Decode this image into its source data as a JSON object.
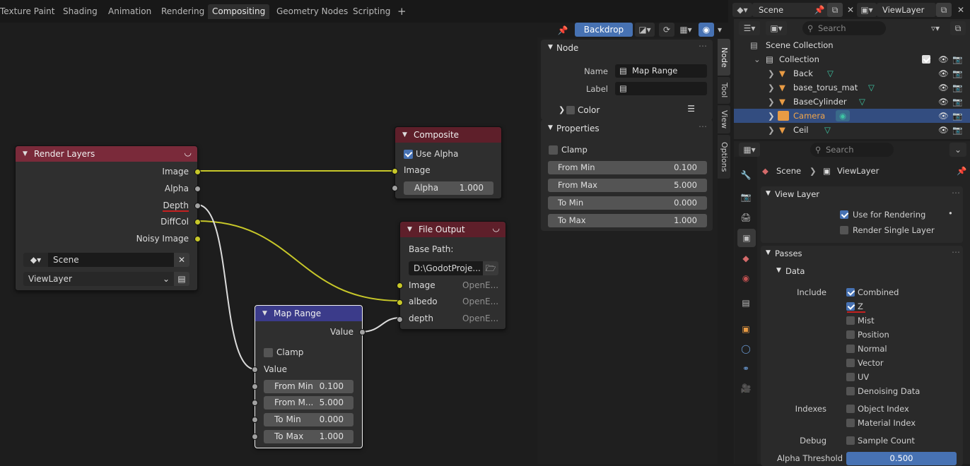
{
  "workspace_tabs": [
    "Texture Paint",
    "Shading",
    "Animation",
    "Rendering",
    "Compositing",
    "Geometry Nodes",
    "Scripting"
  ],
  "active_tab": "Compositing",
  "add_tab_symbol": "+",
  "scene": {
    "name": "Scene",
    "view_layer": "ViewLayer"
  },
  "header": {
    "backdrop_label": "Backdrop"
  },
  "nodes": {
    "render_layers": {
      "title": "Render Layers",
      "outputs": [
        "Image",
        "Alpha",
        "Depth",
        "DiffCol",
        "Noisy Image"
      ],
      "scene": "Scene",
      "view_layer": "ViewLayer"
    },
    "composite": {
      "title": "Composite",
      "use_alpha_label": "Use Alpha",
      "use_alpha": true,
      "input_image": "Image",
      "alpha_label": "Alpha",
      "alpha_value": "1.000"
    },
    "file_output": {
      "title": "File Output",
      "base_path_label": "Base Path:",
      "base_path": "D:\\GodotProje...",
      "inputs": [
        {
          "name": "Image",
          "format": "OpenE..."
        },
        {
          "name": "albedo",
          "format": "OpenE..."
        },
        {
          "name": "depth",
          "format": "OpenE..."
        }
      ]
    },
    "map_range": {
      "title": "Map Range",
      "output": "Value",
      "clamp_label": "Clamp",
      "input_value": "Value",
      "fields": [
        {
          "label": "From Min",
          "value": "0.100"
        },
        {
          "label": "From M...",
          "value": "5.000"
        },
        {
          "label": "To Min",
          "value": "0.000"
        },
        {
          "label": "To Max",
          "value": "1.000"
        }
      ]
    }
  },
  "sidebar": {
    "node_section": "Node",
    "name_label": "Name",
    "name_value": "Map Range",
    "label_label": "Label",
    "label_value": "",
    "color_label": "Color",
    "properties_section": "Properties",
    "clamp_label": "Clamp",
    "fields": [
      {
        "label": "From Min",
        "value": "0.100"
      },
      {
        "label": "From Max",
        "value": "5.000"
      },
      {
        "label": "To Min",
        "value": "0.000"
      },
      {
        "label": "To Max",
        "value": "1.000"
      }
    ],
    "tabs": [
      "Node",
      "Tool",
      "View",
      "Options"
    ]
  },
  "outliner": {
    "search_placeholder": "Search",
    "root": "Scene Collection",
    "collection": "Collection",
    "items": [
      "Back",
      "base_torus_mat",
      "BaseCylinder",
      "Camera",
      "Ceil"
    ],
    "selected": "Camera"
  },
  "properties": {
    "search_placeholder": "Search",
    "breadcrumb_scene": "Scene",
    "breadcrumb_layer": "ViewLayer",
    "view_layer_section": "View Layer",
    "use_for_rendering": "Use for Rendering",
    "render_single_layer": "Render Single Layer",
    "passes_section": "Passes",
    "data_section": "Data",
    "include_label": "Include",
    "include_items": [
      {
        "label": "Combined",
        "checked": true
      },
      {
        "label": "Z",
        "checked": true
      },
      {
        "label": "Mist",
        "checked": false
      },
      {
        "label": "Position",
        "checked": false
      },
      {
        "label": "Normal",
        "checked": false
      },
      {
        "label": "Vector",
        "checked": false
      },
      {
        "label": "UV",
        "checked": false
      },
      {
        "label": "Denoising Data",
        "checked": false
      }
    ],
    "indexes_label": "Indexes",
    "index_items": [
      "Object Index",
      "Material Index"
    ],
    "debug_label": "Debug",
    "debug_item": "Sample Count",
    "alpha_threshold_label": "Alpha Threshold",
    "alpha_threshold_value": "0.500"
  },
  "colors": {
    "render_layers_header": "#7a2a3a",
    "composite_header": "#5e1f2a",
    "file_output_header": "#5e1f2a",
    "map_range_header": "#3b3b8a",
    "socket_yellow": "#c7c729",
    "socket_gray": "#a1a1a1",
    "accent": "#4772b3"
  }
}
